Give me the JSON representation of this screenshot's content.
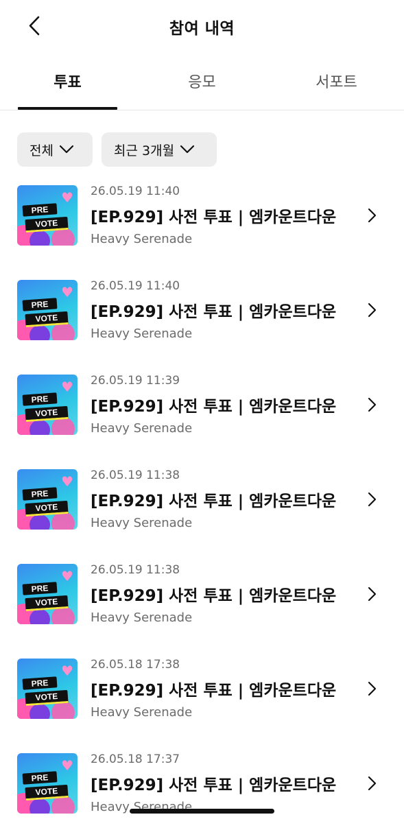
{
  "header": {
    "title": "참여 내역"
  },
  "tabs": [
    {
      "label": "투표",
      "active": true
    },
    {
      "label": "응모",
      "active": false
    },
    {
      "label": "서포트",
      "active": false
    }
  ],
  "filters": {
    "type": "전체",
    "period": "최근 3개월"
  },
  "items": [
    {
      "date": "26.05.19 11:40",
      "title": "[EP.929] 사전 투표 | 엠카운트다운",
      "artist": "Heavy Serenade",
      "thumb_badge_1": "PRE",
      "thumb_badge_2": "VOTE"
    },
    {
      "date": "26.05.19 11:40",
      "title": "[EP.929] 사전 투표 | 엠카운트다운",
      "artist": "Heavy Serenade",
      "thumb_badge_1": "PRE",
      "thumb_badge_2": "VOTE"
    },
    {
      "date": "26.05.19 11:39",
      "title": "[EP.929] 사전 투표 | 엠카운트다운",
      "artist": "Heavy Serenade",
      "thumb_badge_1": "PRE",
      "thumb_badge_2": "VOTE"
    },
    {
      "date": "26.05.19 11:38",
      "title": "[EP.929] 사전 투표 | 엠카운트다운",
      "artist": "Heavy Serenade",
      "thumb_badge_1": "PRE",
      "thumb_badge_2": "VOTE"
    },
    {
      "date": "26.05.19 11:38",
      "title": "[EP.929] 사전 투표 | 엠카운트다운",
      "artist": "Heavy Serenade",
      "thumb_badge_1": "PRE",
      "thumb_badge_2": "VOTE"
    },
    {
      "date": "26.05.18 17:38",
      "title": "[EP.929] 사전 투표 | 엠카운트다운",
      "artist": "Heavy Serenade",
      "thumb_badge_1": "PRE",
      "thumb_badge_2": "VOTE"
    },
    {
      "date": "26.05.18 17:37",
      "title": "[EP.929] 사전 투표 | 엠카운트다운",
      "artist": "Heavy Serenade",
      "thumb_badge_1": "PRE",
      "thumb_badge_2": "VOTE"
    }
  ],
  "icons": {
    "back": "chevron-left-icon",
    "dropdown": "chevron-down-icon",
    "row": "chevron-right-icon"
  },
  "colors": {
    "active_tab": "#111111",
    "inactive_tab": "#555555",
    "chip_bg": "#ededed",
    "secondary_text": "#6b6b6b"
  }
}
